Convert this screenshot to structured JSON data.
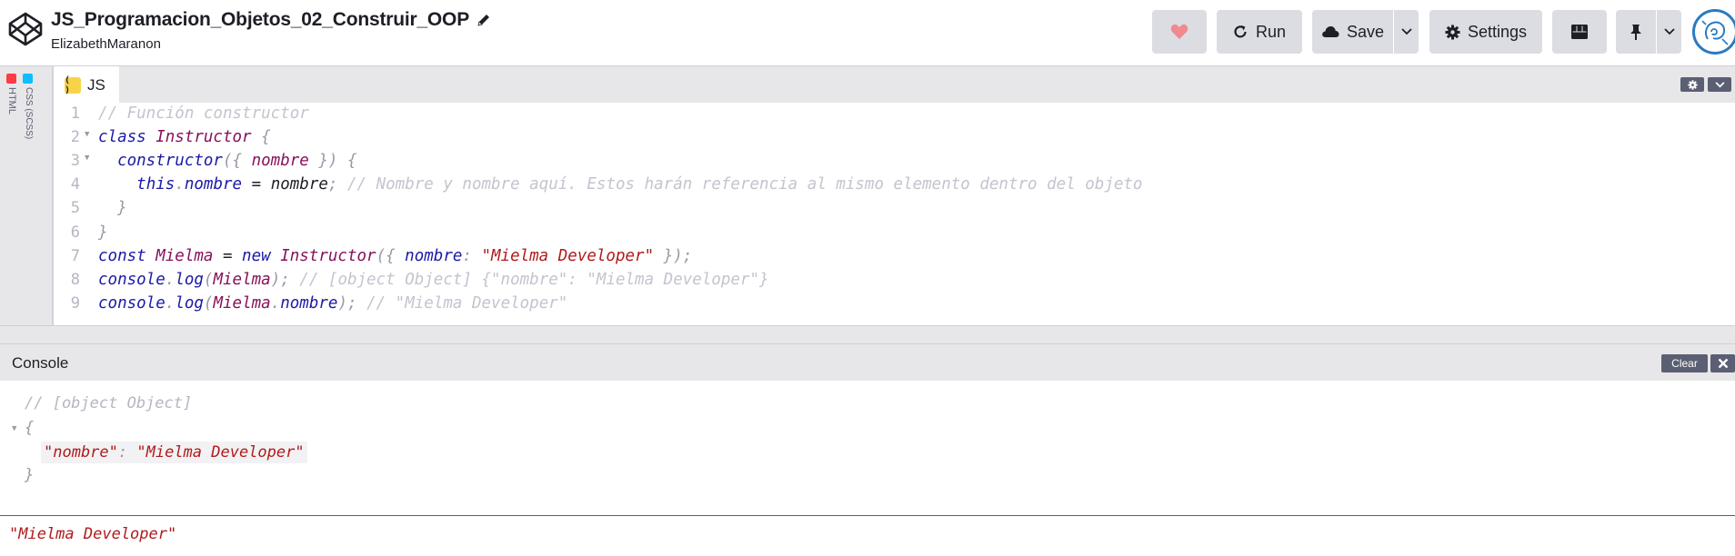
{
  "header": {
    "title": "JS_Programacion_Objetos_02_Construir_OOP",
    "author": "ElizabethMaranon",
    "buttons": {
      "run": "Run",
      "save": "Save",
      "settings": "Settings"
    },
    "icons": {
      "logo": "codepen-logo-icon",
      "edit": "pencil-icon",
      "love": "heart-icon",
      "run": "refresh-icon",
      "save": "cloud-icon",
      "settings": "gear-icon",
      "layout": "layout-icon",
      "pin": "pin-icon",
      "dropdown": "chevron-down-icon"
    },
    "colors": {
      "heart": "#f08a8f",
      "button_bg": "#dcdde3",
      "avatar_ring": "#2a7bc0"
    }
  },
  "side_editors": [
    {
      "label": "HTML",
      "badge_color": "#ff3c41"
    },
    {
      "label": "CSS (SCSS)",
      "badge_color": "#0ebeff"
    }
  ],
  "editor": {
    "tab_label": "JS",
    "tab_badge": "( )",
    "badge_color": "#f7d34a",
    "lines": [
      {
        "n": "1",
        "fold": false,
        "tokens": [
          {
            "t": "// Función constructor",
            "c": "com"
          }
        ]
      },
      {
        "n": "2",
        "fold": true,
        "tokens": [
          {
            "t": "class ",
            "c": "kw"
          },
          {
            "t": "Instructor",
            "c": "cls"
          },
          {
            "t": " {",
            "c": "punc"
          }
        ]
      },
      {
        "n": "3",
        "fold": true,
        "tokens": [
          {
            "t": "  ",
            "c": "plain"
          },
          {
            "t": "constructor",
            "c": "fn"
          },
          {
            "t": "({ ",
            "c": "punc"
          },
          {
            "t": "nombre",
            "c": "var"
          },
          {
            "t": " }) {",
            "c": "punc"
          }
        ]
      },
      {
        "n": "4",
        "fold": false,
        "tokens": [
          {
            "t": "    ",
            "c": "plain"
          },
          {
            "t": "this",
            "c": "kw"
          },
          {
            "t": ".",
            "c": "punc"
          },
          {
            "t": "nombre",
            "c": "attr"
          },
          {
            "t": " = ",
            "c": "plain"
          },
          {
            "t": "nombre",
            "c": "plain"
          },
          {
            "t": "; ",
            "c": "punc"
          },
          {
            "t": "// Nombre y nombre aquí. Estos harán referencia al mismo elemento dentro del objeto",
            "c": "com"
          }
        ]
      },
      {
        "n": "5",
        "fold": false,
        "tokens": [
          {
            "t": "  }",
            "c": "punc"
          }
        ]
      },
      {
        "n": "6",
        "fold": false,
        "tokens": [
          {
            "t": "}",
            "c": "punc"
          }
        ]
      },
      {
        "n": "7",
        "fold": false,
        "tokens": [
          {
            "t": "const ",
            "c": "kw"
          },
          {
            "t": "Mielma",
            "c": "var"
          },
          {
            "t": " = ",
            "c": "plain"
          },
          {
            "t": "new ",
            "c": "kw"
          },
          {
            "t": "Instructor",
            "c": "cls"
          },
          {
            "t": "({ ",
            "c": "punc"
          },
          {
            "t": "nombre",
            "c": "attr"
          },
          {
            "t": ": ",
            "c": "punc"
          },
          {
            "t": "\"Mielma Developer\"",
            "c": "str"
          },
          {
            "t": " });",
            "c": "punc"
          }
        ]
      },
      {
        "n": "8",
        "fold": false,
        "tokens": [
          {
            "t": "console",
            "c": "kw"
          },
          {
            "t": ".",
            "c": "punc"
          },
          {
            "t": "log",
            "c": "fn"
          },
          {
            "t": "(",
            "c": "punc"
          },
          {
            "t": "Mielma",
            "c": "var"
          },
          {
            "t": "); ",
            "c": "punc"
          },
          {
            "t": "// [object Object] {\"nombre\": \"Mielma Developer\"}",
            "c": "com"
          }
        ]
      },
      {
        "n": "9",
        "fold": false,
        "tokens": [
          {
            "t": "console",
            "c": "kw"
          },
          {
            "t": ".",
            "c": "punc"
          },
          {
            "t": "log",
            "c": "fn"
          },
          {
            "t": "(",
            "c": "punc"
          },
          {
            "t": "Mielma",
            "c": "var"
          },
          {
            "t": ".",
            "c": "punc"
          },
          {
            "t": "nombre",
            "c": "attr"
          },
          {
            "t": "); ",
            "c": "punc"
          },
          {
            "t": "// \"Mielma Developer\"",
            "c": "com"
          }
        ]
      }
    ]
  },
  "console": {
    "title": "Console",
    "clear_label": "Clear",
    "comment": "// [object Object]",
    "brace_open": "{",
    "prop_key": "\"nombre\"",
    "prop_colon": ": ",
    "prop_value": "\"Mielma Developer\"",
    "brace_close": "}",
    "result": "\"Mielma Developer\""
  }
}
